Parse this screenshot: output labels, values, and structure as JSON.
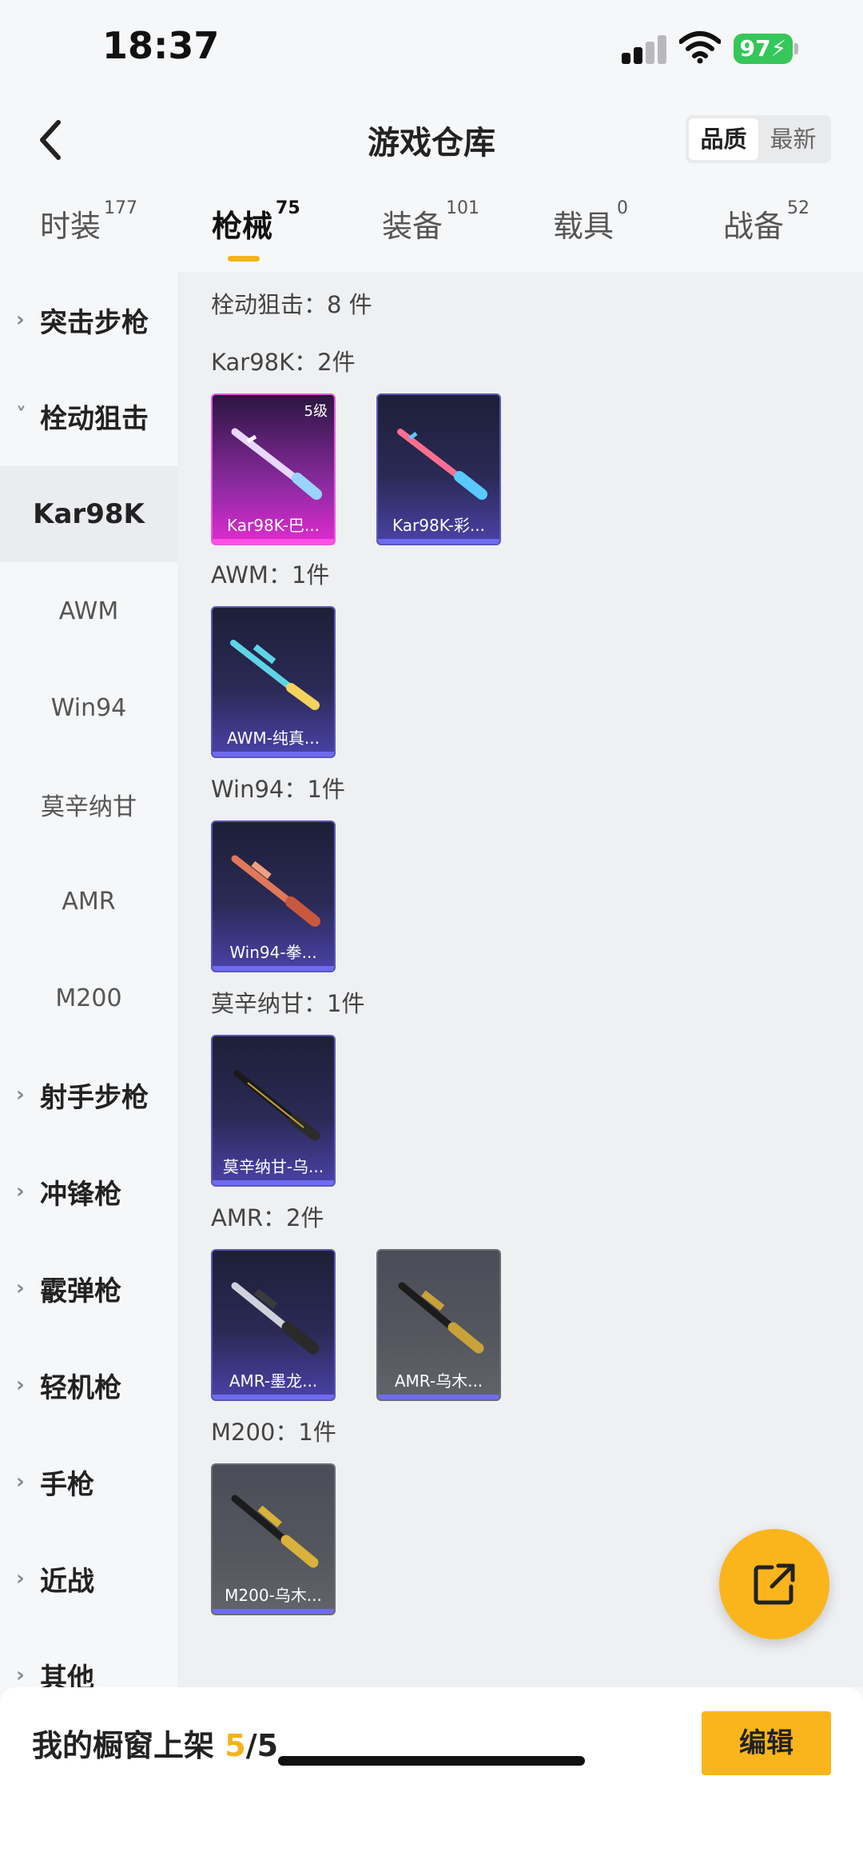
{
  "status_bar": {
    "time": "18:37",
    "battery": "97"
  },
  "header": {
    "title": "游戏仓库",
    "sort_options": [
      "品质",
      "最新"
    ],
    "sort_selected": "品质"
  },
  "category_tabs": [
    {
      "label": "时装",
      "count": "177"
    },
    {
      "label": "枪械",
      "count": "75"
    },
    {
      "label": "装备",
      "count": "101"
    },
    {
      "label": "载具",
      "count": "0"
    },
    {
      "label": "战备",
      "count": "52"
    }
  ],
  "sidebar": {
    "groups": [
      {
        "label": "突击步枪",
        "chevron": "›"
      },
      {
        "label": "栓动狙击",
        "chevron": "˅"
      },
      {
        "label": "射手步枪",
        "chevron": "›"
      },
      {
        "label": "冲锋枪",
        "chevron": "›"
      },
      {
        "label": "霰弹枪",
        "chevron": "›"
      },
      {
        "label": "轻机枪",
        "chevron": "›"
      },
      {
        "label": "手枪",
        "chevron": "›"
      },
      {
        "label": "近战",
        "chevron": "›"
      },
      {
        "label": "其他",
        "chevron": "›"
      }
    ],
    "subitems": [
      "Kar98K",
      "AWM",
      "Win94",
      "莫辛纳甘",
      "AMR",
      "M200"
    ],
    "selected_subitem": "Kar98K"
  },
  "main": {
    "summary": "栓动狙击：8 件",
    "sections": [
      {
        "title": "Kar98K：2件",
        "items": [
          {
            "label": "Kar98K-巴...",
            "level": "5级",
            "rarity": "pink"
          },
          {
            "label": "Kar98K-彩...",
            "rarity": "purple"
          }
        ]
      },
      {
        "title": "AWM：1件",
        "items": [
          {
            "label": "AWM-纯真...",
            "rarity": "purple"
          }
        ]
      },
      {
        "title": "Win94：1件",
        "items": [
          {
            "label": "Win94-拳...",
            "rarity": "purple"
          }
        ]
      },
      {
        "title": "莫辛纳甘：1件",
        "items": [
          {
            "label": "莫辛纳甘-乌...",
            "rarity": "purple"
          }
        ]
      },
      {
        "title": "AMR：2件",
        "items": [
          {
            "label": "AMR-墨龙...",
            "rarity": "purple"
          },
          {
            "label": "AMR-乌木...",
            "rarity": "gray"
          }
        ]
      },
      {
        "title": "M200：1件",
        "items": [
          {
            "label": "M200-乌木...",
            "rarity": "gray"
          }
        ]
      }
    ]
  },
  "bottom_bar": {
    "shelf_label": "我的橱窗上架",
    "shelf_current": "5",
    "shelf_total": "/5",
    "edit_label": "编辑"
  },
  "icons": {
    "back": "chevron-left-icon",
    "share": "external-link-icon",
    "signal": "signal-icon",
    "wifi": "wifi-icon",
    "battery": "battery-icon"
  },
  "colors": {
    "accent": "#f9b51b",
    "active_tab_underline": "#f5b21b",
    "battery": "#35c759"
  }
}
